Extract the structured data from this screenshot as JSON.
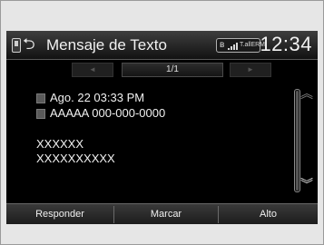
{
  "header": {
    "title": "Mensaje de Texto",
    "carrier_label": "T.allERM",
    "clock": "12:34"
  },
  "pager": {
    "prev_label": "◄",
    "count": "1/1",
    "next_label": "►"
  },
  "message": {
    "date_time": "Ago. 22 03:33 PM",
    "sender": "AAAAA 000-000-0000",
    "body_lines": [
      "XXXXXX",
      "XXXXXXXXXX"
    ]
  },
  "scroll": {
    "up_icon": "chevron-double-up-icon",
    "down_icon": "chevron-double-down-icon"
  },
  "softkeys": {
    "reply": "Responder",
    "dial": "Marcar",
    "stop": "Alto"
  },
  "icons": {
    "phone": "phone-icon",
    "back": "back-arrow-icon",
    "bluetooth": "bluetooth-icon",
    "signal": "signal-bars-icon",
    "calendar": "calendar-icon",
    "contact": "contact-icon"
  }
}
